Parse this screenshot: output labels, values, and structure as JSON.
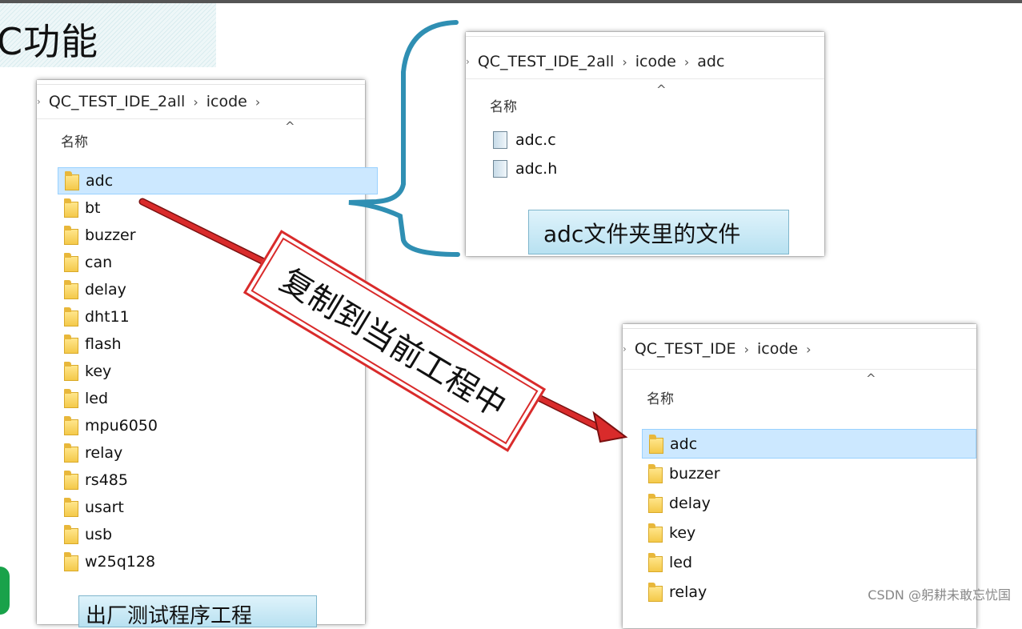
{
  "slide": {
    "title": "C功能",
    "watermark": "CSDN @躬耕未敢忘忧国",
    "arrow_label": "复制到当前工程中",
    "callout_adc": "adc文件夹里的文件",
    "callout_bottom": "出厂测试程序工程"
  },
  "left_explorer": {
    "breadcrumb": [
      "QC_TEST_IDE_2all",
      "icode"
    ],
    "column_header": "名称",
    "sort_icon": "^",
    "items": [
      "adc",
      "bt",
      "buzzer",
      "can",
      "delay",
      "dht11",
      "flash",
      "key",
      "led",
      "mpu6050",
      "relay",
      "rs485",
      "usart",
      "usb",
      "w25q128"
    ],
    "selected": "adc"
  },
  "top_right_explorer": {
    "breadcrumb": [
      "QC_TEST_IDE_2all",
      "icode",
      "adc"
    ],
    "column_header": "名称",
    "sort_icon": "^",
    "files": [
      "adc.c",
      "adc.h"
    ]
  },
  "bottom_right_explorer": {
    "breadcrumb": [
      "QC_TEST_IDE",
      "icode"
    ],
    "column_header": "名称",
    "sort_icon": "^",
    "items": [
      "adc",
      "buzzer",
      "delay",
      "key",
      "led",
      "relay"
    ],
    "selected": "adc"
  },
  "colors": {
    "selection_bg": "#cce8ff",
    "bracket": "#2f8fb3",
    "arrow": "#d92b2b",
    "folder": "#f4c94a"
  },
  "icons": {
    "folder": "folder-icon",
    "file": "text-file-icon",
    "breadcrumb_separator": "chevron-right-icon",
    "sort": "sort-ascending-icon"
  }
}
